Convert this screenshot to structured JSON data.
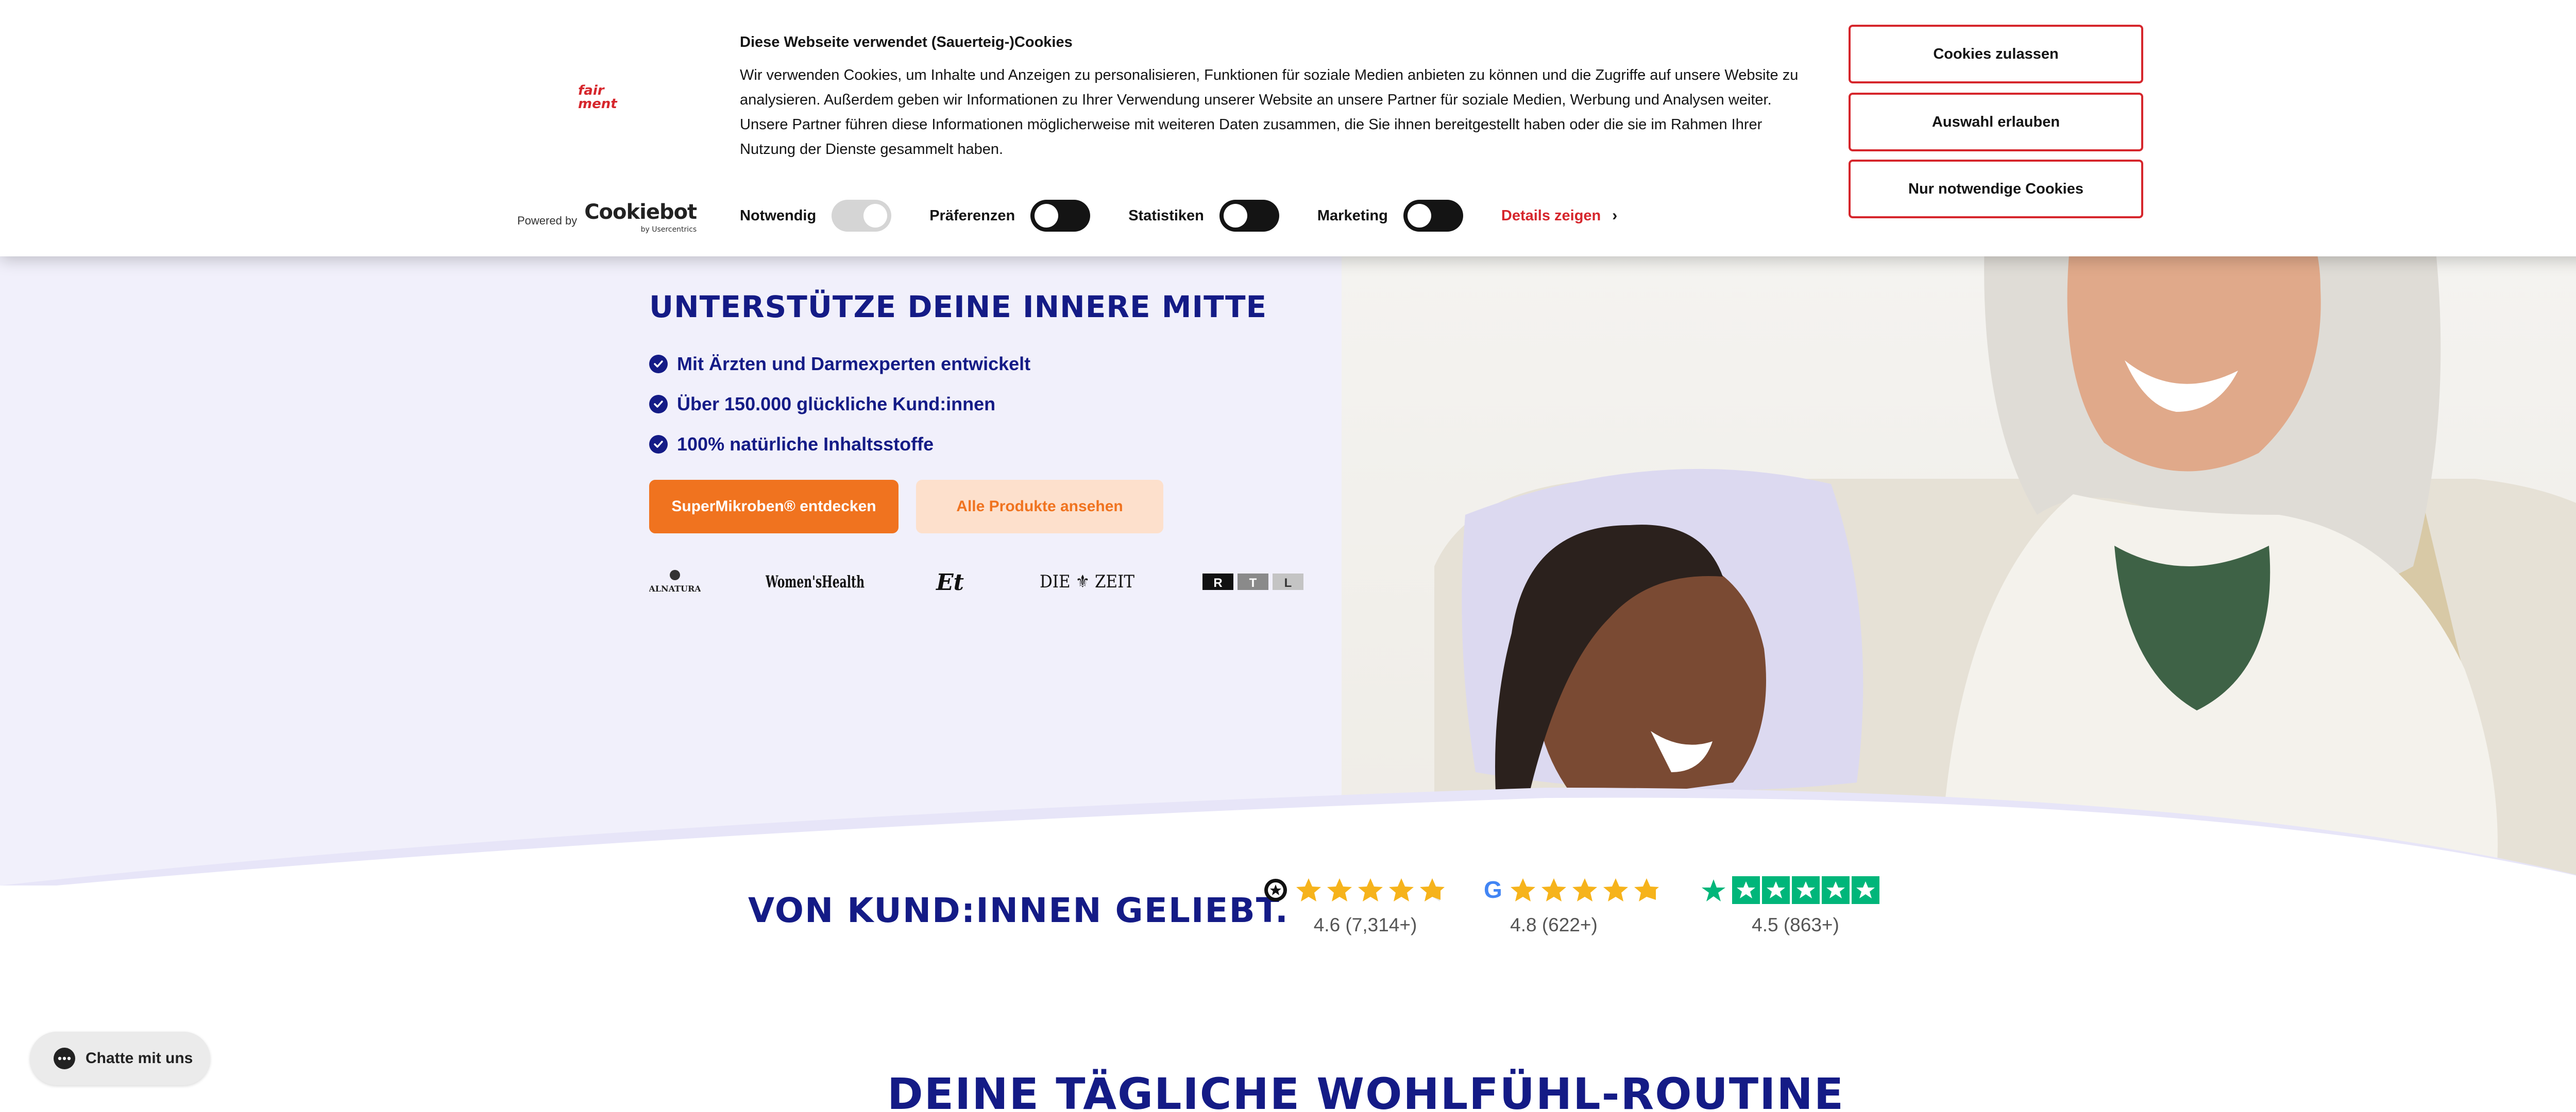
{
  "cookie_banner": {
    "title": "Diese Webseite verwendet (Sauerteig-)Cookies",
    "text": "Wir verwenden Cookies, um Inhalte und Anzeigen zu personalisieren, Funktionen für soziale Medien anbieten zu können und die Zugriffe auf unsere Website zu analysieren. Außerdem geben wir Informationen zu Ihrer Verwendung unserer Website an unsere Partner für soziale Medien, Werbung und Analysen weiter. Unsere Partner führen diese Informationen möglicherweise mit weiteren Daten zusammen, die Sie ihnen bereitgestellt haben oder die sie im Rahmen Ihrer Nutzung der Dienste gesammelt haben.",
    "brand_logo": "fairment",
    "powered_by": "Powered by",
    "cookiebot": "Cookiebot",
    "usercentrics": "by Usercentrics",
    "toggles": [
      {
        "label": "Notwendig",
        "state": "on-disabled"
      },
      {
        "label": "Präferenzen",
        "state": "off"
      },
      {
        "label": "Statistiken",
        "state": "off"
      },
      {
        "label": "Marketing",
        "state": "off"
      }
    ],
    "details_label": "Details zeigen",
    "buttons": {
      "allow_all": "Cookies zulassen",
      "allow_selection": "Auswahl erlauben",
      "necessary_only": "Nur notwendige Cookies"
    }
  },
  "hero": {
    "title": "UNTERSTÜTZE DEINE INNERE MITTE",
    "checks": [
      "Mit Ärzten und Darmexperten entwickelt",
      "Über 150.000 glückliche Kund:innen",
      "100% natürliche Inhaltsstoffe"
    ],
    "primary_button": "SuperMikroben® entdecken",
    "secondary_button": "Alle Produkte ansehen",
    "press_logos": [
      "Alnatura",
      "WomensHealth",
      "Elle",
      "DIE ZEIT",
      "RTL"
    ]
  },
  "reviews": {
    "title": "VON KUND:INNEN GELIEBT.",
    "items": [
      {
        "source": "Trusted Shops",
        "rating": 4.6,
        "score_text": "4.6 (7,314+)"
      },
      {
        "source": "Google",
        "rating": 4.8,
        "score_text": "4.8 (622+)"
      },
      {
        "source": "Trustpilot",
        "rating": 4.5,
        "score_text": "4.5 (863+)"
      }
    ]
  },
  "routine_title": "DEINE TÄGLICHE WOHLFÜHL-ROUTINE",
  "chat": {
    "label": "Chatte mit uns"
  },
  "colors": {
    "navy": "#141b86",
    "orange": "#f0731f",
    "peach": "#fde0cc",
    "cookie_red": "#d6262c",
    "star_yellow": "#f6b31b",
    "trustpilot_green": "#00b67a",
    "hero_bg": "#f1f0fb"
  }
}
